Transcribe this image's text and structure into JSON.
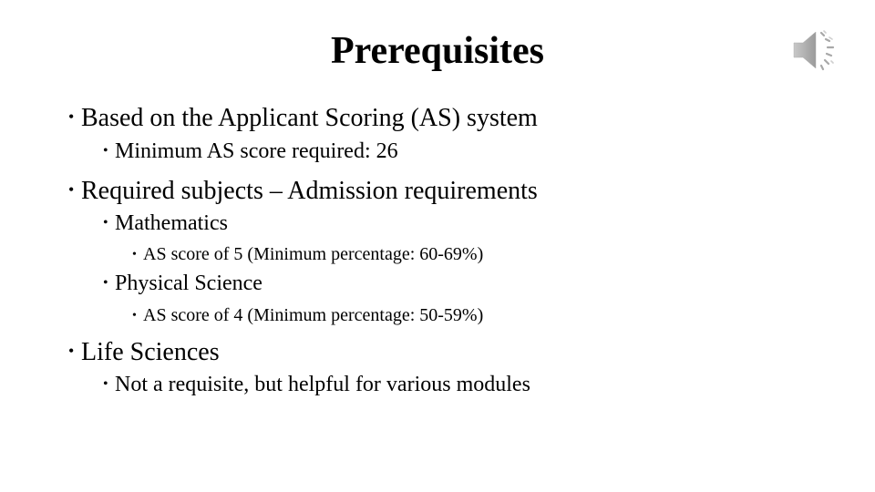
{
  "slide": {
    "title": "Prerequisites",
    "audio_icon": "speaker-icon",
    "bullets": [
      {
        "level": 1,
        "text": "Based on the Applicant Scoring (AS) system"
      },
      {
        "level": 2,
        "text": "Minimum AS score required: 26"
      },
      {
        "level": 1,
        "text": "Required subjects – Admission requirements"
      },
      {
        "level": 2,
        "text": "Mathematics"
      },
      {
        "level": 3,
        "text": "AS score of 5 (Minimum percentage: 60-69%)"
      },
      {
        "level": 2,
        "text": "Physical Science"
      },
      {
        "level": 3,
        "text": "AS score of 4 (Minimum percentage: 50-59%)"
      },
      {
        "level": 1,
        "text": "Life Sciences"
      },
      {
        "level": 2,
        "text": "Not a requisite, but helpful for various modules"
      }
    ],
    "bullet_glyph": "•"
  }
}
